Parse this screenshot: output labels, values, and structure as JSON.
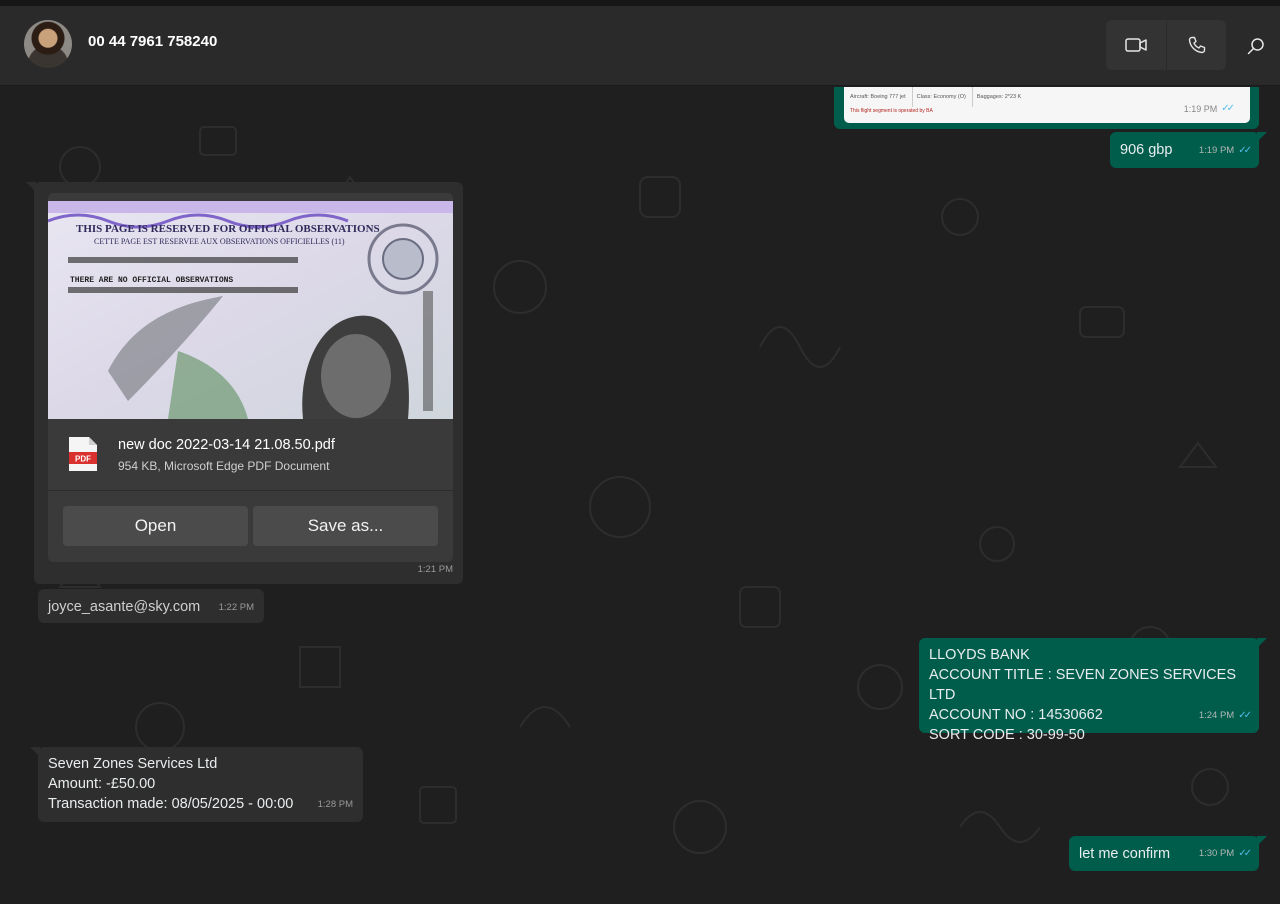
{
  "header": {
    "contact_name": "00 44 7961 758240",
    "icons": [
      "video-call-icon",
      "voice-call-icon",
      "search-icon"
    ]
  },
  "flight_card": {
    "aircraft": "Aircraft: Boeing 777 jet",
    "class": "Class: Economy (O)",
    "baggages": "Baggages: 2*23 K",
    "note": "This flight segment is operated by BA",
    "time": "1:19 PM"
  },
  "messages": [
    {
      "direction": "out",
      "text": "906 gbp",
      "time": "1:19 PM"
    },
    {
      "direction": "in",
      "type": "document",
      "preview_text_1": "THIS PAGE IS RESERVED FOR OFFICIAL OBSERVATIONS",
      "preview_text_2": "CETTE PAGE EST RESERVEE AUX OBSERVATIONS OFFICIELLES (11)",
      "preview_text_3": "THERE ARE NO OFFICIAL OBSERVATIONS",
      "file_icon": "PDF",
      "file_name": "new doc 2022-03-14 21.08.50.pdf",
      "file_info": "954 KB, Microsoft Edge PDF Document",
      "open_label": "Open",
      "save_label": "Save as...",
      "time": "1:21 PM"
    },
    {
      "direction": "in",
      "text": "joyce_asante@sky.com",
      "time": "1:22 PM"
    },
    {
      "direction": "out",
      "lines": [
        "LLOYDS BANK",
        "ACCOUNT TITLE : SEVEN ZONES SERVICES LTD",
        "ACCOUNT NO : 14530662",
        "SORT CODE : 30-99-50"
      ],
      "time": "1:24 PM"
    },
    {
      "direction": "in",
      "lines": [
        "Seven Zones Services Ltd",
        "Amount: -£50.00",
        "Transaction made: 08/05/2025 - 00:00"
      ],
      "time": "1:28 PM"
    },
    {
      "direction": "out",
      "text": "let me confirm",
      "time": "1:30 PM"
    }
  ],
  "colors": {
    "outgoing_bubble": "#005c4b",
    "incoming_bubble": "#2e2e2e",
    "background": "#1f1f1f",
    "read_ticks": "#53bdeb"
  }
}
